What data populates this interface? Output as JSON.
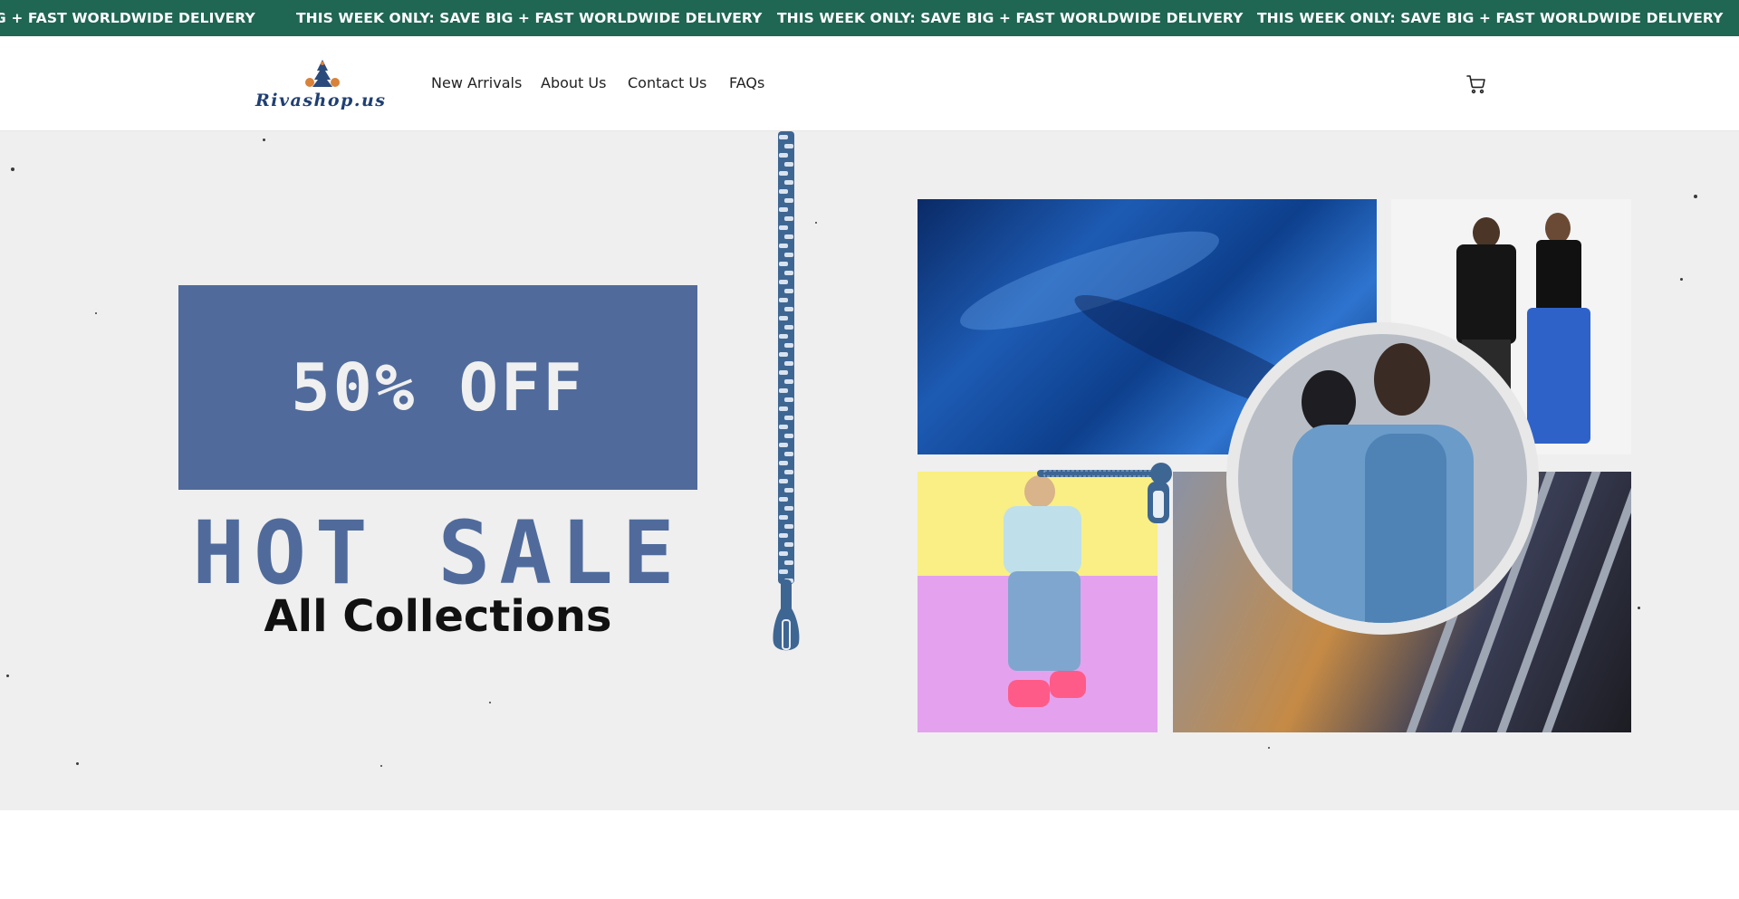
{
  "announcement": {
    "items": [
      "G + FAST WORLDWIDE DELIVERY",
      "THIS WEEK ONLY: SAVE BIG + FAST WORLDWIDE DELIVERY",
      "THIS WEEK ONLY: SAVE BIG + FAST WORLDWIDE DELIVERY",
      "THIS WEEK ONLY: SAVE BIG + FAST WORLDWIDE DELIVERY"
    ],
    "background": "#1f6653"
  },
  "header": {
    "logo_text": "Rivashop.us",
    "nav": [
      {
        "label": "New Arrivals"
      },
      {
        "label": "About Us"
      },
      {
        "label": "Contact Us"
      },
      {
        "label": "FAQs"
      }
    ],
    "cart_icon": "cart-icon"
  },
  "hero": {
    "discount": "50% OFF",
    "headline": "HOT SALE",
    "subheadline": "All Collections",
    "accent_color": "#506b9b",
    "background": "#efefef"
  }
}
